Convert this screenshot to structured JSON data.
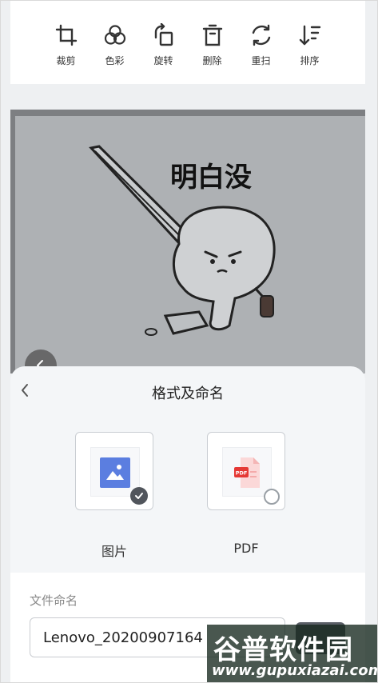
{
  "toolbar": {
    "items": [
      {
        "label": "裁剪",
        "icon": "crop-icon"
      },
      {
        "label": "色彩",
        "icon": "color-icon"
      },
      {
        "label": "旋转",
        "icon": "rotate-icon"
      },
      {
        "label": "删除",
        "icon": "trash-icon"
      },
      {
        "label": "重扫",
        "icon": "rescan-icon"
      },
      {
        "label": "排序",
        "icon": "sort-icon"
      }
    ]
  },
  "photo": {
    "caption": "明白没"
  },
  "sheet": {
    "back_icon": "chevron-left-icon",
    "title": "格式及命名",
    "formats": [
      {
        "label": "图片",
        "icon": "image-icon",
        "selected": true
      },
      {
        "label": "PDF",
        "icon": "pdf-icon",
        "selected": false
      }
    ],
    "name_label": "文件命名",
    "name_value": "Lenovo_20200907164"
  },
  "watermark": {
    "title": "谷普软件园",
    "url": "www.gupuxiazai.com"
  },
  "colors": {
    "accent_image": "#5b7ee0",
    "pdf_red": "#e53935",
    "check_dark": "#51555c"
  }
}
